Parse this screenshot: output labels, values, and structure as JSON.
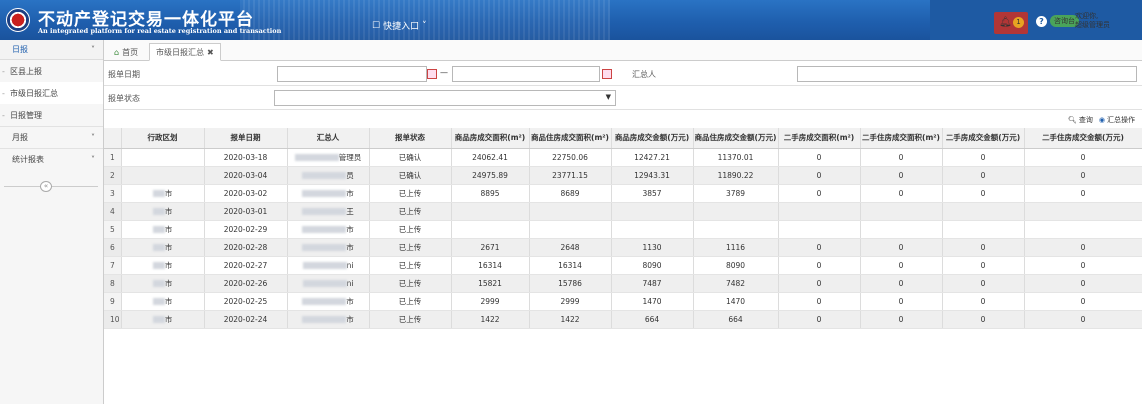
{
  "header": {
    "title": "不动产登记交易一体化平台",
    "subtitle": "An integrated platform for real estate registration and transaction",
    "quick_entry": "快捷入口",
    "notification_count": "1",
    "green_tag": "咨询台",
    "welcome_line1": "欢迎你,",
    "welcome_line2": "超级管理员"
  },
  "sidebar": {
    "daily_section": "日报",
    "items": [
      {
        "label": "区县上报"
      },
      {
        "label": "市级日报汇总"
      },
      {
        "label": "日报管理"
      }
    ],
    "groups": [
      {
        "label": "月报"
      },
      {
        "label": "统计报表"
      }
    ],
    "collapse_glyph": "«"
  },
  "tabs": {
    "home": "首页",
    "active": "市级日报汇总"
  },
  "form": {
    "report_date_label": "报单日期",
    "date_separator": "—",
    "collector_label": "汇总人",
    "status_label": "报单状态"
  },
  "toolbar": {
    "query": "查询",
    "summary": "汇总操作"
  },
  "table": {
    "columns": [
      "行政区划",
      "报单日期",
      "汇总人",
      "报单状态",
      "商品房成交面积(m²)",
      "商品住房成交面积(m²)",
      "商品房成交金额(万元)",
      "商品住房成交金额(万元)",
      "二手房成交面积(m²)",
      "二手住房成交面积(m²)",
      "二手房成交金额(万元)",
      "二手住房成交金额(万元)"
    ],
    "rows": [
      {
        "n": "1",
        "region": "",
        "date": "2020-03-18",
        "person": "管理员",
        "status": "已确认",
        "c1": "24062.41",
        "c2": "22750.06",
        "c3": "12427.21",
        "c4": "11370.01",
        "c5": "0",
        "c6": "0",
        "c7": "0",
        "c8": "0"
      },
      {
        "n": "2",
        "region": "",
        "date": "2020-03-04",
        "person": "员",
        "status": "已确认",
        "c1": "24975.89",
        "c2": "23771.15",
        "c3": "12943.31",
        "c4": "11890.22",
        "c5": "0",
        "c6": "0",
        "c7": "0",
        "c8": "0"
      },
      {
        "n": "3",
        "region": "市",
        "date": "2020-03-02",
        "person": "市",
        "status": "已上传",
        "c1": "8895",
        "c2": "8689",
        "c3": "3857",
        "c4": "3789",
        "c5": "0",
        "c6": "0",
        "c7": "0",
        "c8": "0"
      },
      {
        "n": "4",
        "region": "市",
        "date": "2020-03-01",
        "person": "王",
        "status": "已上传",
        "c1": "",
        "c2": "",
        "c3": "",
        "c4": "",
        "c5": "",
        "c6": "",
        "c7": "",
        "c8": ""
      },
      {
        "n": "5",
        "region": "市",
        "date": "2020-02-29",
        "person": "市",
        "status": "已上传",
        "c1": "",
        "c2": "",
        "c3": "",
        "c4": "",
        "c5": "",
        "c6": "",
        "c7": "",
        "c8": ""
      },
      {
        "n": "6",
        "region": "市",
        "date": "2020-02-28",
        "person": "市",
        "status": "已上传",
        "c1": "2671",
        "c2": "2648",
        "c3": "1130",
        "c4": "1116",
        "c5": "0",
        "c6": "0",
        "c7": "0",
        "c8": "0"
      },
      {
        "n": "7",
        "region": "市",
        "date": "2020-02-27",
        "person": "ni",
        "status": "已上传",
        "c1": "16314",
        "c2": "16314",
        "c3": "8090",
        "c4": "8090",
        "c5": "0",
        "c6": "0",
        "c7": "0",
        "c8": "0"
      },
      {
        "n": "8",
        "region": "市",
        "date": "2020-02-26",
        "person": "ni",
        "status": "已上传",
        "c1": "15821",
        "c2": "15786",
        "c3": "7487",
        "c4": "7482",
        "c5": "0",
        "c6": "0",
        "c7": "0",
        "c8": "0"
      },
      {
        "n": "9",
        "region": "市",
        "date": "2020-02-25",
        "person": "市",
        "status": "已上传",
        "c1": "2999",
        "c2": "2999",
        "c3": "1470",
        "c4": "1470",
        "c5": "0",
        "c6": "0",
        "c7": "0",
        "c8": "0"
      },
      {
        "n": "10",
        "region": "市",
        "date": "2020-02-24",
        "person": "市",
        "status": "已上传",
        "c1": "1422",
        "c2": "1422",
        "c3": "664",
        "c4": "664",
        "c5": "0",
        "c6": "0",
        "c7": "0",
        "c8": "0"
      }
    ]
  },
  "colors": {
    "header_blue": "#1f5fae",
    "alert_red": "#b23636",
    "badge_orange": "#e8a322",
    "tag_green": "#4aa35a"
  }
}
